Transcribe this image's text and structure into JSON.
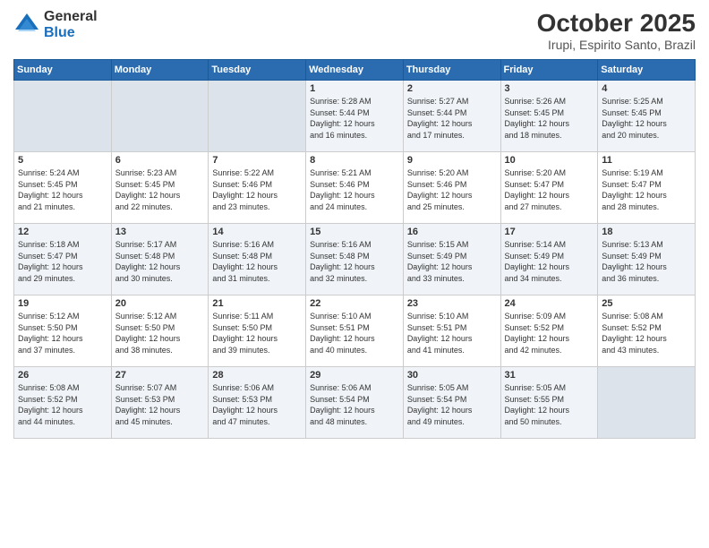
{
  "logo": {
    "general": "General",
    "blue": "Blue"
  },
  "header": {
    "month": "October 2025",
    "location": "Irupi, Espirito Santo, Brazil"
  },
  "weekdays": [
    "Sunday",
    "Monday",
    "Tuesday",
    "Wednesday",
    "Thursday",
    "Friday",
    "Saturday"
  ],
  "weeks": [
    [
      {
        "day": "",
        "info": ""
      },
      {
        "day": "",
        "info": ""
      },
      {
        "day": "",
        "info": ""
      },
      {
        "day": "1",
        "info": "Sunrise: 5:28 AM\nSunset: 5:44 PM\nDaylight: 12 hours\nand 16 minutes."
      },
      {
        "day": "2",
        "info": "Sunrise: 5:27 AM\nSunset: 5:44 PM\nDaylight: 12 hours\nand 17 minutes."
      },
      {
        "day": "3",
        "info": "Sunrise: 5:26 AM\nSunset: 5:45 PM\nDaylight: 12 hours\nand 18 minutes."
      },
      {
        "day": "4",
        "info": "Sunrise: 5:25 AM\nSunset: 5:45 PM\nDaylight: 12 hours\nand 20 minutes."
      }
    ],
    [
      {
        "day": "5",
        "info": "Sunrise: 5:24 AM\nSunset: 5:45 PM\nDaylight: 12 hours\nand 21 minutes."
      },
      {
        "day": "6",
        "info": "Sunrise: 5:23 AM\nSunset: 5:45 PM\nDaylight: 12 hours\nand 22 minutes."
      },
      {
        "day": "7",
        "info": "Sunrise: 5:22 AM\nSunset: 5:46 PM\nDaylight: 12 hours\nand 23 minutes."
      },
      {
        "day": "8",
        "info": "Sunrise: 5:21 AM\nSunset: 5:46 PM\nDaylight: 12 hours\nand 24 minutes."
      },
      {
        "day": "9",
        "info": "Sunrise: 5:20 AM\nSunset: 5:46 PM\nDaylight: 12 hours\nand 25 minutes."
      },
      {
        "day": "10",
        "info": "Sunrise: 5:20 AM\nSunset: 5:47 PM\nDaylight: 12 hours\nand 27 minutes."
      },
      {
        "day": "11",
        "info": "Sunrise: 5:19 AM\nSunset: 5:47 PM\nDaylight: 12 hours\nand 28 minutes."
      }
    ],
    [
      {
        "day": "12",
        "info": "Sunrise: 5:18 AM\nSunset: 5:47 PM\nDaylight: 12 hours\nand 29 minutes."
      },
      {
        "day": "13",
        "info": "Sunrise: 5:17 AM\nSunset: 5:48 PM\nDaylight: 12 hours\nand 30 minutes."
      },
      {
        "day": "14",
        "info": "Sunrise: 5:16 AM\nSunset: 5:48 PM\nDaylight: 12 hours\nand 31 minutes."
      },
      {
        "day": "15",
        "info": "Sunrise: 5:16 AM\nSunset: 5:48 PM\nDaylight: 12 hours\nand 32 minutes."
      },
      {
        "day": "16",
        "info": "Sunrise: 5:15 AM\nSunset: 5:49 PM\nDaylight: 12 hours\nand 33 minutes."
      },
      {
        "day": "17",
        "info": "Sunrise: 5:14 AM\nSunset: 5:49 PM\nDaylight: 12 hours\nand 34 minutes."
      },
      {
        "day": "18",
        "info": "Sunrise: 5:13 AM\nSunset: 5:49 PM\nDaylight: 12 hours\nand 36 minutes."
      }
    ],
    [
      {
        "day": "19",
        "info": "Sunrise: 5:12 AM\nSunset: 5:50 PM\nDaylight: 12 hours\nand 37 minutes."
      },
      {
        "day": "20",
        "info": "Sunrise: 5:12 AM\nSunset: 5:50 PM\nDaylight: 12 hours\nand 38 minutes."
      },
      {
        "day": "21",
        "info": "Sunrise: 5:11 AM\nSunset: 5:50 PM\nDaylight: 12 hours\nand 39 minutes."
      },
      {
        "day": "22",
        "info": "Sunrise: 5:10 AM\nSunset: 5:51 PM\nDaylight: 12 hours\nand 40 minutes."
      },
      {
        "day": "23",
        "info": "Sunrise: 5:10 AM\nSunset: 5:51 PM\nDaylight: 12 hours\nand 41 minutes."
      },
      {
        "day": "24",
        "info": "Sunrise: 5:09 AM\nSunset: 5:52 PM\nDaylight: 12 hours\nand 42 minutes."
      },
      {
        "day": "25",
        "info": "Sunrise: 5:08 AM\nSunset: 5:52 PM\nDaylight: 12 hours\nand 43 minutes."
      }
    ],
    [
      {
        "day": "26",
        "info": "Sunrise: 5:08 AM\nSunset: 5:52 PM\nDaylight: 12 hours\nand 44 minutes."
      },
      {
        "day": "27",
        "info": "Sunrise: 5:07 AM\nSunset: 5:53 PM\nDaylight: 12 hours\nand 45 minutes."
      },
      {
        "day": "28",
        "info": "Sunrise: 5:06 AM\nSunset: 5:53 PM\nDaylight: 12 hours\nand 47 minutes."
      },
      {
        "day": "29",
        "info": "Sunrise: 5:06 AM\nSunset: 5:54 PM\nDaylight: 12 hours\nand 48 minutes."
      },
      {
        "day": "30",
        "info": "Sunrise: 5:05 AM\nSunset: 5:54 PM\nDaylight: 12 hours\nand 49 minutes."
      },
      {
        "day": "31",
        "info": "Sunrise: 5:05 AM\nSunset: 5:55 PM\nDaylight: 12 hours\nand 50 minutes."
      },
      {
        "day": "",
        "info": ""
      }
    ]
  ]
}
